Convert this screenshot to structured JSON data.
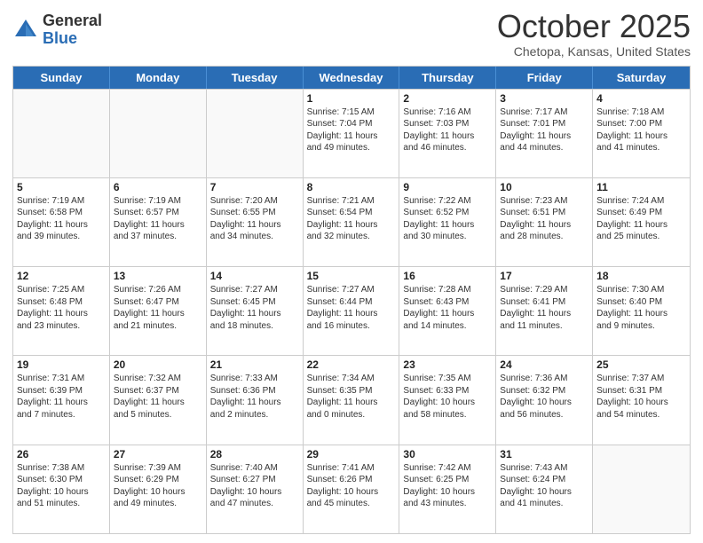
{
  "header": {
    "logo_general": "General",
    "logo_blue": "Blue",
    "month_title": "October 2025",
    "location": "Chetopa, Kansas, United States"
  },
  "days_of_week": [
    "Sunday",
    "Monday",
    "Tuesday",
    "Wednesday",
    "Thursday",
    "Friday",
    "Saturday"
  ],
  "weeks": [
    [
      {
        "day": "",
        "info": ""
      },
      {
        "day": "",
        "info": ""
      },
      {
        "day": "",
        "info": ""
      },
      {
        "day": "1",
        "info": "Sunrise: 7:15 AM\nSunset: 7:04 PM\nDaylight: 11 hours\nand 49 minutes."
      },
      {
        "day": "2",
        "info": "Sunrise: 7:16 AM\nSunset: 7:03 PM\nDaylight: 11 hours\nand 46 minutes."
      },
      {
        "day": "3",
        "info": "Sunrise: 7:17 AM\nSunset: 7:01 PM\nDaylight: 11 hours\nand 44 minutes."
      },
      {
        "day": "4",
        "info": "Sunrise: 7:18 AM\nSunset: 7:00 PM\nDaylight: 11 hours\nand 41 minutes."
      }
    ],
    [
      {
        "day": "5",
        "info": "Sunrise: 7:19 AM\nSunset: 6:58 PM\nDaylight: 11 hours\nand 39 minutes."
      },
      {
        "day": "6",
        "info": "Sunrise: 7:19 AM\nSunset: 6:57 PM\nDaylight: 11 hours\nand 37 minutes."
      },
      {
        "day": "7",
        "info": "Sunrise: 7:20 AM\nSunset: 6:55 PM\nDaylight: 11 hours\nand 34 minutes."
      },
      {
        "day": "8",
        "info": "Sunrise: 7:21 AM\nSunset: 6:54 PM\nDaylight: 11 hours\nand 32 minutes."
      },
      {
        "day": "9",
        "info": "Sunrise: 7:22 AM\nSunset: 6:52 PM\nDaylight: 11 hours\nand 30 minutes."
      },
      {
        "day": "10",
        "info": "Sunrise: 7:23 AM\nSunset: 6:51 PM\nDaylight: 11 hours\nand 28 minutes."
      },
      {
        "day": "11",
        "info": "Sunrise: 7:24 AM\nSunset: 6:49 PM\nDaylight: 11 hours\nand 25 minutes."
      }
    ],
    [
      {
        "day": "12",
        "info": "Sunrise: 7:25 AM\nSunset: 6:48 PM\nDaylight: 11 hours\nand 23 minutes."
      },
      {
        "day": "13",
        "info": "Sunrise: 7:26 AM\nSunset: 6:47 PM\nDaylight: 11 hours\nand 21 minutes."
      },
      {
        "day": "14",
        "info": "Sunrise: 7:27 AM\nSunset: 6:45 PM\nDaylight: 11 hours\nand 18 minutes."
      },
      {
        "day": "15",
        "info": "Sunrise: 7:27 AM\nSunset: 6:44 PM\nDaylight: 11 hours\nand 16 minutes."
      },
      {
        "day": "16",
        "info": "Sunrise: 7:28 AM\nSunset: 6:43 PM\nDaylight: 11 hours\nand 14 minutes."
      },
      {
        "day": "17",
        "info": "Sunrise: 7:29 AM\nSunset: 6:41 PM\nDaylight: 11 hours\nand 11 minutes."
      },
      {
        "day": "18",
        "info": "Sunrise: 7:30 AM\nSunset: 6:40 PM\nDaylight: 11 hours\nand 9 minutes."
      }
    ],
    [
      {
        "day": "19",
        "info": "Sunrise: 7:31 AM\nSunset: 6:39 PM\nDaylight: 11 hours\nand 7 minutes."
      },
      {
        "day": "20",
        "info": "Sunrise: 7:32 AM\nSunset: 6:37 PM\nDaylight: 11 hours\nand 5 minutes."
      },
      {
        "day": "21",
        "info": "Sunrise: 7:33 AM\nSunset: 6:36 PM\nDaylight: 11 hours\nand 2 minutes."
      },
      {
        "day": "22",
        "info": "Sunrise: 7:34 AM\nSunset: 6:35 PM\nDaylight: 11 hours\nand 0 minutes."
      },
      {
        "day": "23",
        "info": "Sunrise: 7:35 AM\nSunset: 6:33 PM\nDaylight: 10 hours\nand 58 minutes."
      },
      {
        "day": "24",
        "info": "Sunrise: 7:36 AM\nSunset: 6:32 PM\nDaylight: 10 hours\nand 56 minutes."
      },
      {
        "day": "25",
        "info": "Sunrise: 7:37 AM\nSunset: 6:31 PM\nDaylight: 10 hours\nand 54 minutes."
      }
    ],
    [
      {
        "day": "26",
        "info": "Sunrise: 7:38 AM\nSunset: 6:30 PM\nDaylight: 10 hours\nand 51 minutes."
      },
      {
        "day": "27",
        "info": "Sunrise: 7:39 AM\nSunset: 6:29 PM\nDaylight: 10 hours\nand 49 minutes."
      },
      {
        "day": "28",
        "info": "Sunrise: 7:40 AM\nSunset: 6:27 PM\nDaylight: 10 hours\nand 47 minutes."
      },
      {
        "day": "29",
        "info": "Sunrise: 7:41 AM\nSunset: 6:26 PM\nDaylight: 10 hours\nand 45 minutes."
      },
      {
        "day": "30",
        "info": "Sunrise: 7:42 AM\nSunset: 6:25 PM\nDaylight: 10 hours\nand 43 minutes."
      },
      {
        "day": "31",
        "info": "Sunrise: 7:43 AM\nSunset: 6:24 PM\nDaylight: 10 hours\nand 41 minutes."
      },
      {
        "day": "",
        "info": ""
      }
    ]
  ]
}
